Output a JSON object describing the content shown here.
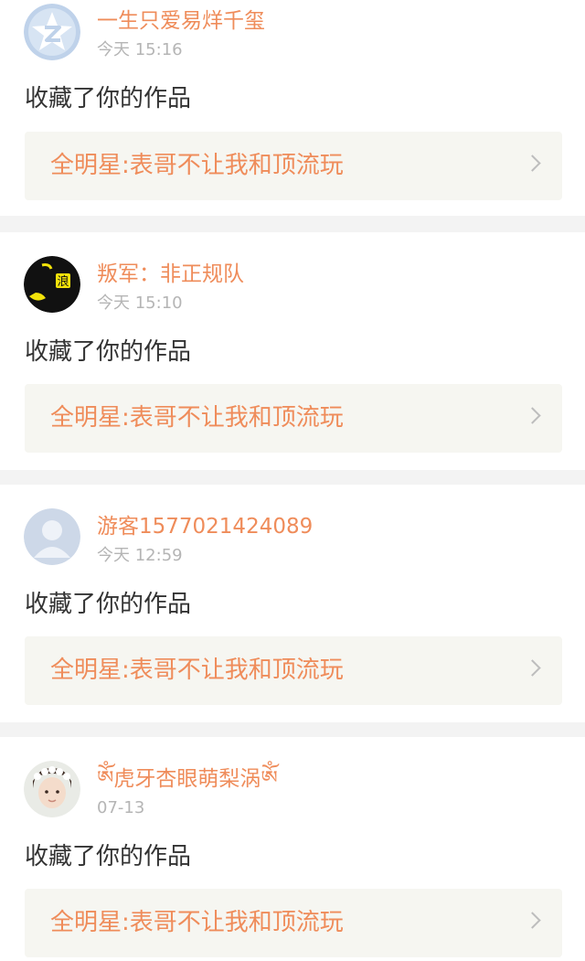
{
  "notifications": [
    {
      "username": "一生只爱易烊千玺",
      "time": "今天 15:16",
      "action": "收藏了你的作品",
      "work_title": "全明星:表哥不让我和顶流玩",
      "avatar": "qzone-logo-avatar"
    },
    {
      "username": "叛军：非正规队",
      "time": "今天 15:10",
      "action": "收藏了你的作品",
      "work_title": "全明星:表哥不让我和顶流玩",
      "avatar": "dark-avatar",
      "avatar_text": "浪"
    },
    {
      "username": "游客1577021424089",
      "time": "今天 12:59",
      "action": "收藏了你的作品",
      "work_title": "全明星:表哥不让我和顶流玩",
      "avatar": "default-person-avatar"
    },
    {
      "username": "ༀ虎牙杏眼萌梨涡ༀ",
      "time": "07-13",
      "action": "收藏了你的作品",
      "work_title": "全明星:表哥不让我和顶流玩",
      "avatar": "photo-avatar"
    }
  ],
  "colors": {
    "accent": "#ef8c5a",
    "time_gray": "#b5b5b5",
    "link_bg": "#f6f6f1",
    "separator": "#f3f3f3",
    "text": "#333333"
  }
}
